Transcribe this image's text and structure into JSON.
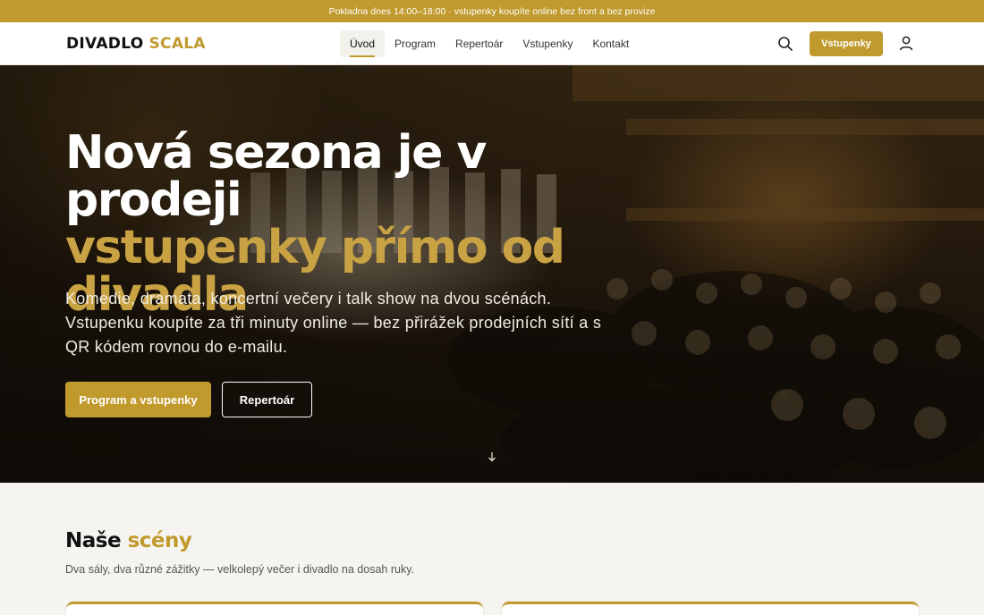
{
  "announcement": "Pokladna dnes 14:00–18:00 · vstupenky koupíte online bez front a bez provize",
  "brand": {
    "part1": "DIVADLO",
    "part2": "SCALA"
  },
  "nav": {
    "items": [
      {
        "label": "Úvod",
        "active": true
      },
      {
        "label": "Program"
      },
      {
        "label": "Repertoár"
      },
      {
        "label": "Vstupenky"
      },
      {
        "label": "Kontakt"
      }
    ],
    "tickets_button": "Vstupenky",
    "icons": [
      "search-icon",
      "user-icon"
    ]
  },
  "hero": {
    "title_line1": "Nová sezona je v prodeji",
    "title_line2": "vstupenky přímo od divadla",
    "text": "Komedie, dramata, koncertní večery i talk show na dvou scénách. Vstupenku koupíte za tři minuty online — bez přirážek prodejních sítí a s QR kódem rovnou do e-mailu.",
    "primary_button": "Program a vstupenky",
    "secondary_button": "Repertoár",
    "scroll_icon": "arrow-down-icon"
  },
  "scenes": {
    "title_part1": "Naše",
    "title_part2": "scény",
    "subtitle": "Dva sály, dva různé zážitky — velkolepý večer i divadlo na dosah ruky."
  },
  "colors": {
    "accent": "#c19a2e",
    "dark": "#1a1a1a",
    "background": "#f6f4f1"
  }
}
